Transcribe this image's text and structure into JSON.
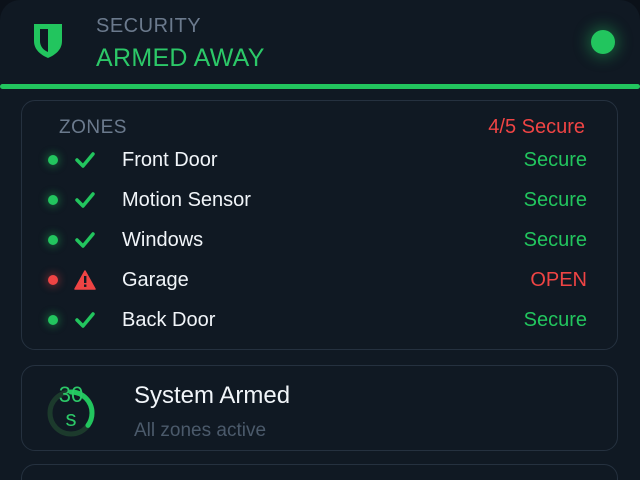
{
  "header": {
    "label": "SECURITY",
    "status": "ARMED AWAY",
    "status_indicator": "armed",
    "accent_color": "#22c55e",
    "icon": "shield-icon"
  },
  "zones": {
    "title": "ZONES",
    "summary": "4/5 Secure",
    "items": [
      {
        "name": "Front Door",
        "state": "Secure",
        "ok": true,
        "icon": "check-icon"
      },
      {
        "name": "Motion Sensor",
        "state": "Secure",
        "ok": true,
        "icon": "check-icon"
      },
      {
        "name": "Windows",
        "state": "Secure",
        "ok": true,
        "icon": "check-icon"
      },
      {
        "name": "Garage",
        "state": "OPEN",
        "ok": false,
        "icon": "warning-icon"
      },
      {
        "name": "Back Door",
        "state": "Secure",
        "ok": true,
        "icon": "check-icon"
      }
    ]
  },
  "system": {
    "timer": "30\ns",
    "timer_progress": 0.35,
    "title": "System Armed",
    "subtitle": "All zones active"
  },
  "colors": {
    "ok": "#22c55e",
    "alert": "#ef4444",
    "muted": "#6b7a8d"
  }
}
